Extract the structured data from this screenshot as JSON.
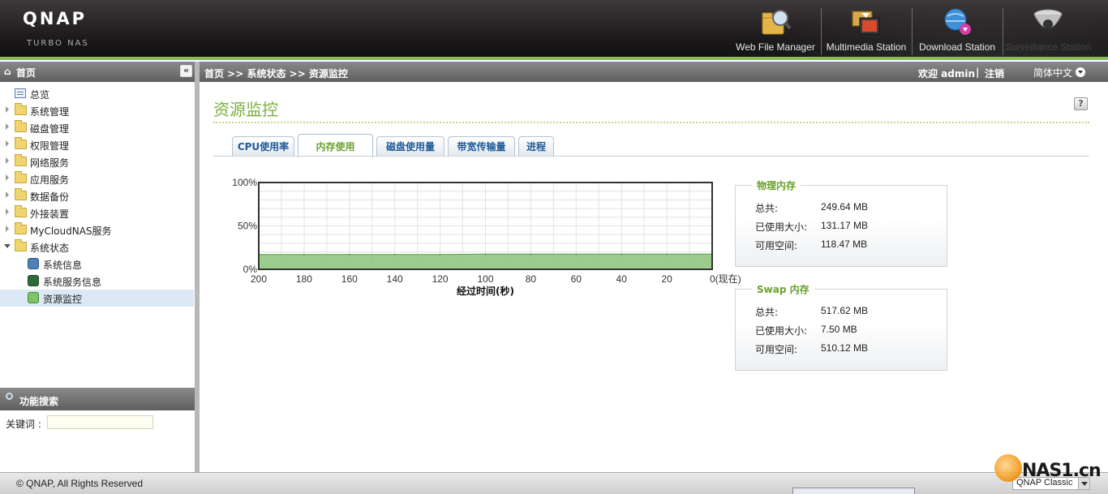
{
  "header": {
    "logo": "QNAP",
    "logo_sub": "Turbo NAS",
    "apps": [
      {
        "label": "Web File Manager",
        "icon": "web-file-manager-icon"
      },
      {
        "label": "Multimedia Station",
        "icon": "multimedia-station-icon"
      },
      {
        "label": "Download Station",
        "icon": "download-station-icon"
      },
      {
        "label": "Surveillance Station",
        "icon": "surveillance-station-icon"
      }
    ]
  },
  "sidebar": {
    "title": "首页",
    "items": [
      {
        "label": "总览"
      },
      {
        "label": "系统管理"
      },
      {
        "label": "磁盘管理"
      },
      {
        "label": "权限管理"
      },
      {
        "label": "网络服务"
      },
      {
        "label": "应用服务"
      },
      {
        "label": "数据备份"
      },
      {
        "label": "外接装置"
      },
      {
        "label": "MyCloudNAS服务"
      },
      {
        "label": "系统状态",
        "children": [
          {
            "label": "系统信息"
          },
          {
            "label": "系统服务信息"
          },
          {
            "label": "资源监控",
            "selected": true
          }
        ]
      }
    ],
    "search": {
      "title": "功能搜索",
      "keyword_label": "关键词 :",
      "value": ""
    }
  },
  "nav": {
    "breadcrumb": "首页 >> 系统状态 >> 资源监控",
    "welcome": "欢迎 admin",
    "separator": "|",
    "logout": "注销",
    "language": "简体中文"
  },
  "main": {
    "title": "资源监控",
    "tabs": [
      {
        "label": "CPU使用率"
      },
      {
        "label": "内存使用",
        "active": true
      },
      {
        "label": "磁盘使用量"
      },
      {
        "label": "带宽传输量"
      },
      {
        "label": "进程"
      }
    ],
    "physical": {
      "title": "物理内存",
      "rows": [
        {
          "label": "总共:",
          "value": "249.64 MB"
        },
        {
          "label": "已使用大小:",
          "value": "131.17 MB"
        },
        {
          "label": "可用空间:",
          "value": "118.47 MB"
        }
      ]
    },
    "swap": {
      "title": "Swap 内存",
      "rows": [
        {
          "label": "总共:",
          "value": "517.62 MB"
        },
        {
          "label": "已使用大小:",
          "value": "7.50 MB"
        },
        {
          "label": "可用空间:",
          "value": "510.12 MB"
        }
      ]
    }
  },
  "chart_data": {
    "type": "area",
    "xlabel": "经过时间(秒)",
    "ylabel": "",
    "x_ticks": [
      "200",
      "180",
      "160",
      "140",
      "120",
      "100",
      "80",
      "60",
      "40",
      "20",
      "0(现在)"
    ],
    "y_ticks": [
      "100%",
      "50%",
      "0%"
    ],
    "xlim": [
      200,
      0
    ],
    "ylim": [
      0,
      100
    ],
    "grid": true,
    "series": [
      {
        "color": "#8cc47a",
        "x": [
          200,
          180,
          160,
          140,
          120,
          100,
          80,
          60,
          40,
          20,
          0
        ],
        "values": [
          17,
          17,
          17,
          17,
          17,
          17.5,
          17.5,
          17.5,
          17.5,
          17.5,
          17.5
        ]
      }
    ]
  },
  "footer": {
    "copyright": "© QNAP, All Rights Reserved",
    "theme": "QNAP Classic",
    "watermark": "NAS1.cn"
  },
  "colors": {
    "accent_green": "#7ab03c",
    "tab_blue": "#1f5b99",
    "header_dark": "#1a1718"
  }
}
